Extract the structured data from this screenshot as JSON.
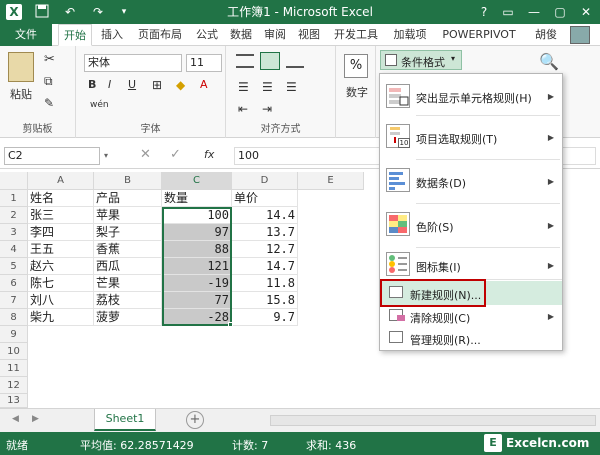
{
  "window": {
    "title": "工作簿1 - Microsoft Excel",
    "icons": [
      "excel-logo-icon",
      "save-icon",
      "undo-icon",
      "redo-icon",
      "customize-icon"
    ],
    "controls": [
      "?",
      "▭",
      "—",
      "▢",
      "✕"
    ]
  },
  "ribbon_tabs": [
    "文件",
    "开始",
    "插入",
    "页面布局",
    "公式",
    "数据",
    "审阅",
    "视图",
    "开发工具",
    "加载项",
    "POWERPIVOT"
  ],
  "user": "胡俊",
  "ribbon": {
    "clipboard_label": "剪贴板",
    "paste_label": "粘贴",
    "font_label": "字体",
    "font_name": "宋体",
    "font_size": "11",
    "bold": "B",
    "italic": "I",
    "underline": "U",
    "wen": "wén",
    "alignment_label": "对齐方式",
    "number_label": "数字",
    "percent": "%",
    "cond_format": "条件格式"
  },
  "formula_bar": {
    "name_box": "C2",
    "fx": "fx",
    "value": "100"
  },
  "grid": {
    "columns": [
      "A",
      "B",
      "C",
      "D",
      "E"
    ],
    "rows": [
      "1",
      "2",
      "3",
      "4",
      "5",
      "6",
      "7",
      "8",
      "9",
      "10",
      "11",
      "12",
      "13"
    ],
    "header_row": {
      "a": "姓名",
      "b": "产品",
      "c": "数量",
      "d": "单价"
    },
    "data": [
      {
        "a": "张三",
        "b": "苹果",
        "c": "100",
        "d": "14.4"
      },
      {
        "a": "李四",
        "b": "梨子",
        "c": "97",
        "d": "13.7"
      },
      {
        "a": "王五",
        "b": "香蕉",
        "c": "88",
        "d": "12.7"
      },
      {
        "a": "赵六",
        "b": "西瓜",
        "c": "121",
        "d": "14.7"
      },
      {
        "a": "陈七",
        "b": "芒果",
        "c": "-19",
        "d": "11.8"
      },
      {
        "a": "刘八",
        "b": "荔枝",
        "c": "77",
        "d": "15.8"
      },
      {
        "a": "柴九",
        "b": "菠萝",
        "c": "-28",
        "d": "9.7"
      }
    ]
  },
  "sheet_tab": "Sheet1",
  "status": {
    "ready": "就绪",
    "average": "平均值: 62.28571429",
    "count": "计数: 7",
    "sum": "求和: 436",
    "watermark": "Excelcn.com"
  },
  "menu": {
    "items": [
      {
        "label": "突出显示单元格规则(H)",
        "arrow": "▶"
      },
      {
        "label": "项目选取规则(T)",
        "arrow": "▶",
        "icon_text": "10"
      },
      {
        "label": "数据条(D)",
        "arrow": "▶"
      },
      {
        "label": "色阶(S)",
        "arrow": "▶"
      },
      {
        "label": "图标集(I)",
        "arrow": "▶"
      },
      {
        "label": "新建规则(N)..."
      },
      {
        "label": "清除规则(C)",
        "arrow": "▶"
      },
      {
        "label": "管理规则(R)..."
      }
    ]
  }
}
